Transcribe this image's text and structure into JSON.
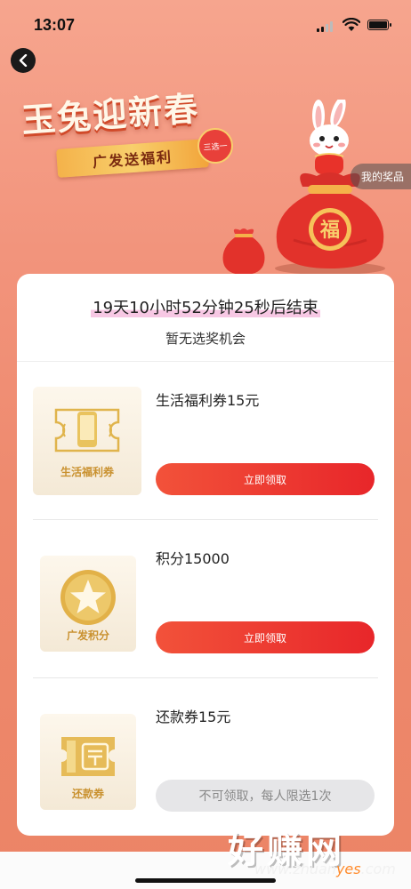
{
  "status": {
    "time": "13:07"
  },
  "hero": {
    "title": "玉兔迎新春",
    "ribbon": "广发送福利",
    "tag": "三选一",
    "bag_char": "福",
    "my_prize_label": "我的奖品"
  },
  "card": {
    "countdown": "19天10小时52分钟25秒后结束",
    "no_chance": "暂无选奖机会",
    "prizes": [
      {
        "name": "生活福利券15元",
        "caption": "生活福利券",
        "button": "立即领取",
        "icon": "phone-ticket-icon"
      },
      {
        "name": "积分15000",
        "caption": "广发积分",
        "button": "立即领取",
        "icon": "star-coin-icon"
      },
      {
        "name": "还款券15元",
        "caption": "还款券",
        "button": "不可领取，每人限选1次",
        "icon": "repay-ticket-icon"
      }
    ]
  },
  "watermark": {
    "text": "好赚网",
    "url_pre": "www.zhuan",
    "url_hl": "yes",
    "url_post": ".com"
  },
  "colors": {
    "accent": "#e8262a",
    "gold": "#c9912f",
    "bg": "#ee8a6e"
  }
}
